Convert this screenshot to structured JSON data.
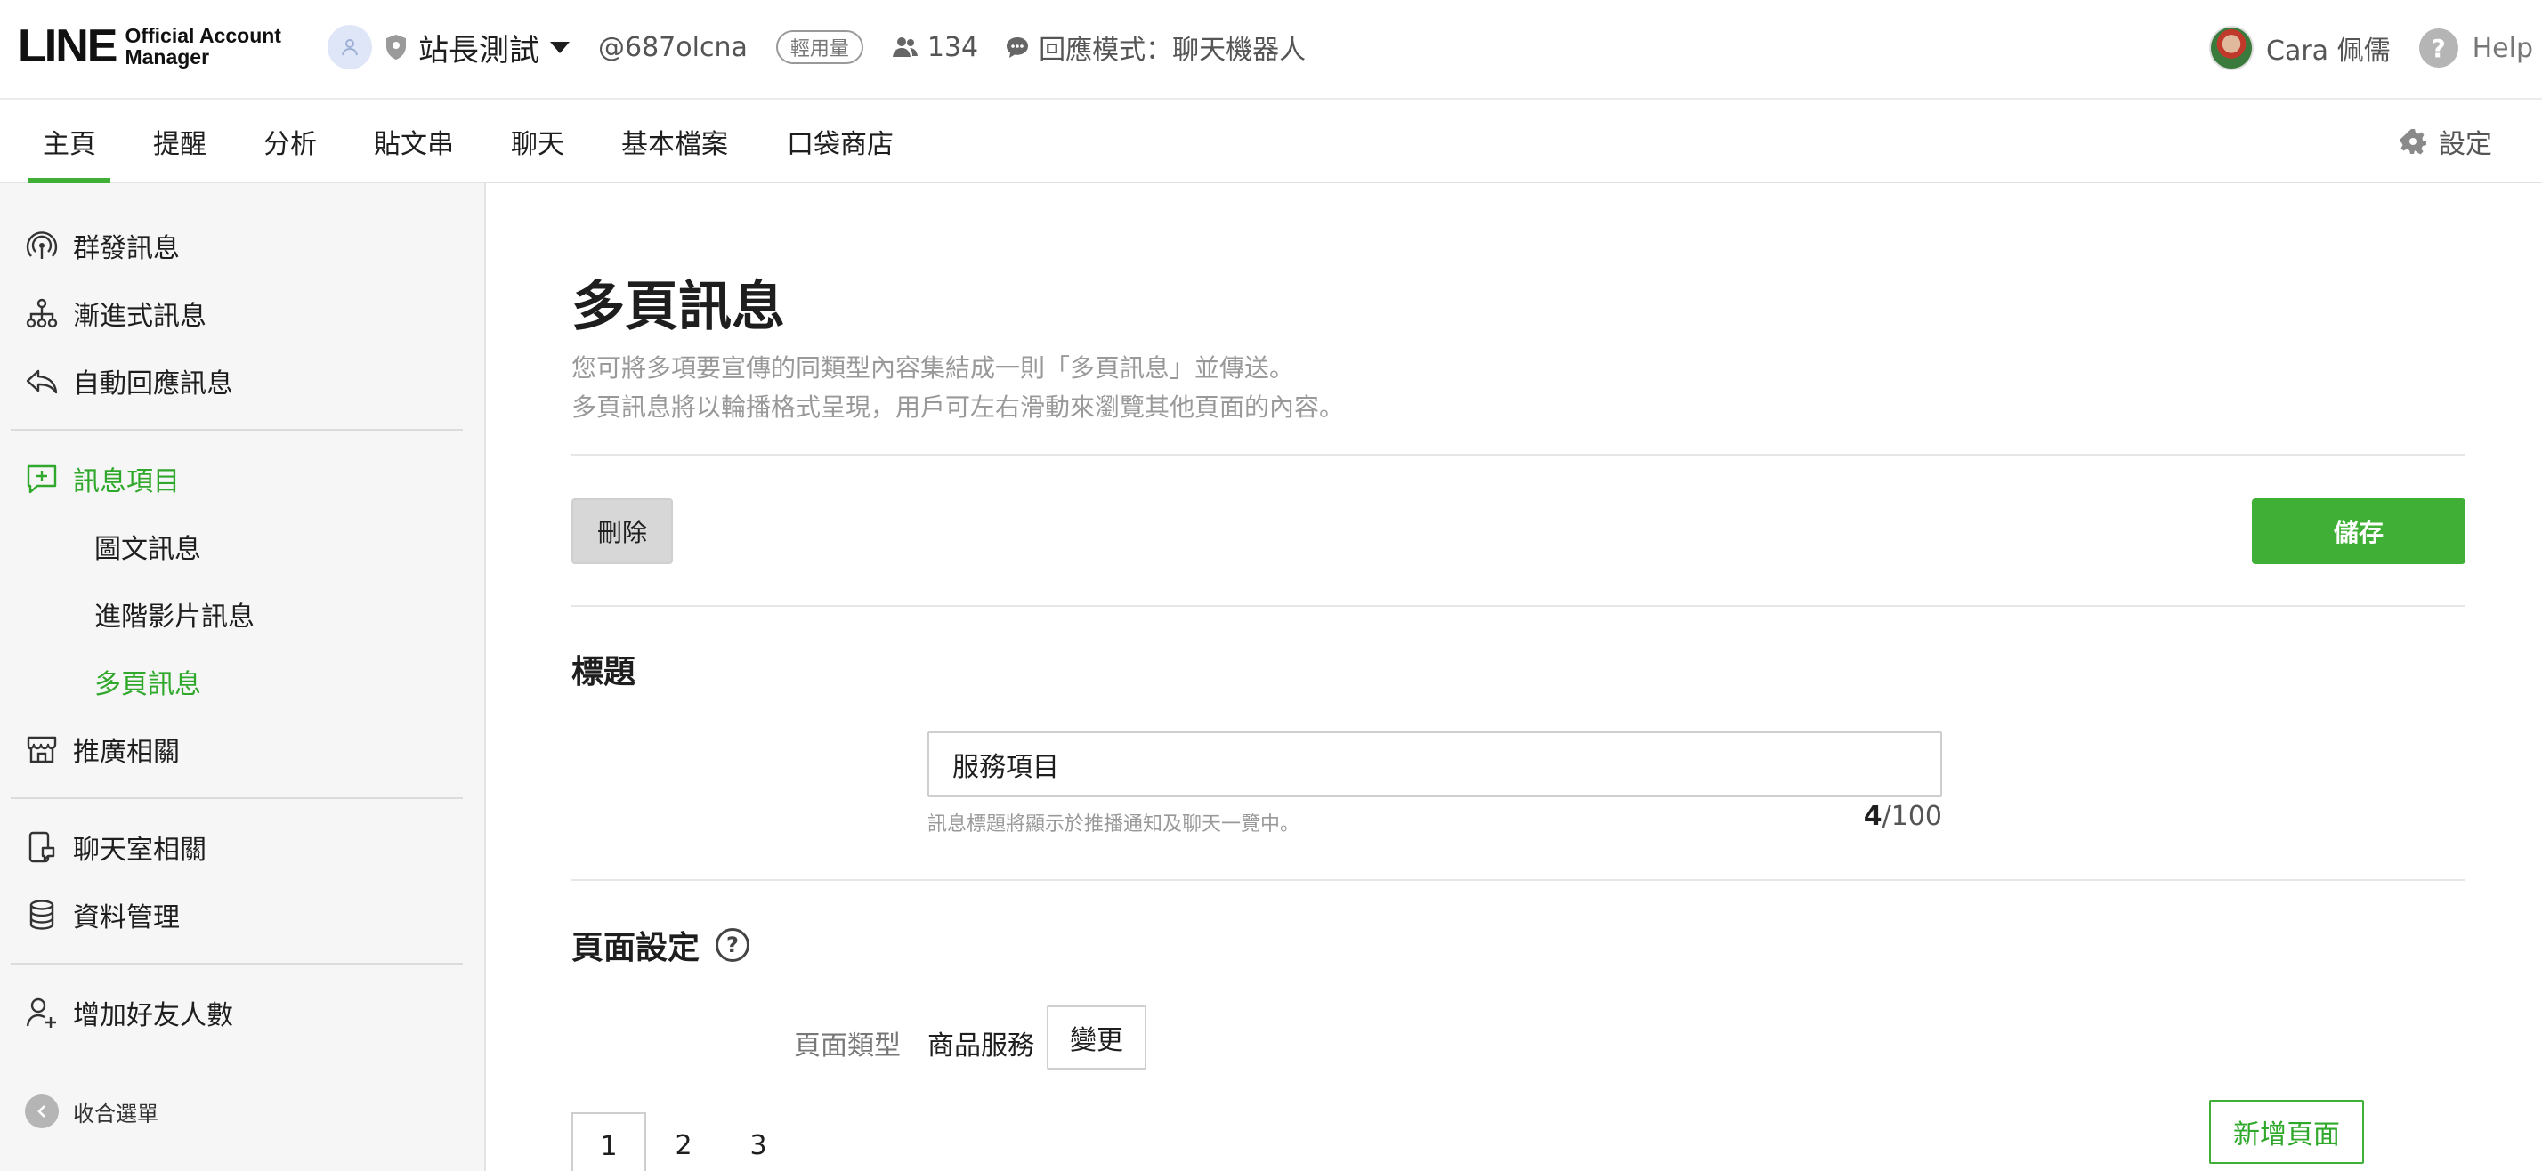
{
  "header": {
    "logo_main": "LINE",
    "logo_sub_line1": "Official Account",
    "logo_sub_line2": "Manager",
    "account_name": "站長測試",
    "account_id": "@687olcna",
    "plan_badge": "輕用量",
    "friend_count": "134",
    "response_mode": "回應模式：聊天機器人",
    "user_name": "Cara 佩儒",
    "help_label": "Help"
  },
  "tabs": [
    {
      "label": "主頁",
      "active": true
    },
    {
      "label": "提醒"
    },
    {
      "label": "分析"
    },
    {
      "label": "貼文串"
    },
    {
      "label": "聊天"
    },
    {
      "label": "基本檔案"
    },
    {
      "label": "口袋商店"
    }
  ],
  "settings_label": "設定",
  "sidebar": {
    "items": [
      {
        "label": "群發訊息",
        "icon": "broadcast-icon"
      },
      {
        "label": "漸進式訊息",
        "icon": "step-flow-icon"
      },
      {
        "label": "自動回應訊息",
        "icon": "reply-icon"
      },
      {
        "label": "訊息項目",
        "icon": "message-plus-icon",
        "active": true
      },
      {
        "label": "推廣相關",
        "icon": "store-icon"
      },
      {
        "label": "聊天室相關",
        "icon": "chatroom-icon"
      },
      {
        "label": "資料管理",
        "icon": "database-icon"
      },
      {
        "label": "增加好友人數",
        "icon": "add-friend-icon"
      }
    ],
    "subitems": [
      {
        "label": "圖文訊息"
      },
      {
        "label": "進階影片訊息"
      },
      {
        "label": "多頁訊息",
        "active": true
      }
    ],
    "collapse_label": "收合選單"
  },
  "main": {
    "title": "多頁訊息",
    "desc_line1": "您可將多項要宣傳的同類型內容集結成一則「多頁訊息」並傳送。",
    "desc_line2": "多頁訊息將以輪播格式呈現，用戶可左右滑動來瀏覽其他頁面的內容。",
    "delete_label": "刪除",
    "save_label": "儲存",
    "title_section": "標題",
    "title_value": "服務項目",
    "title_hint": "訊息標題將顯示於推播通知及聊天一覽中。",
    "title_count": "4",
    "title_max": "/100",
    "page_settings_section": "頁面設定",
    "page_type_label": "頁面類型",
    "page_type_value": "商品服務",
    "change_label": "變更",
    "page_tabs": [
      "1",
      "2",
      "3"
    ],
    "add_page_label": "新增頁面"
  },
  "colors": {
    "brand_green": "#3fb035",
    "active_green_text": "#2fa82b"
  }
}
